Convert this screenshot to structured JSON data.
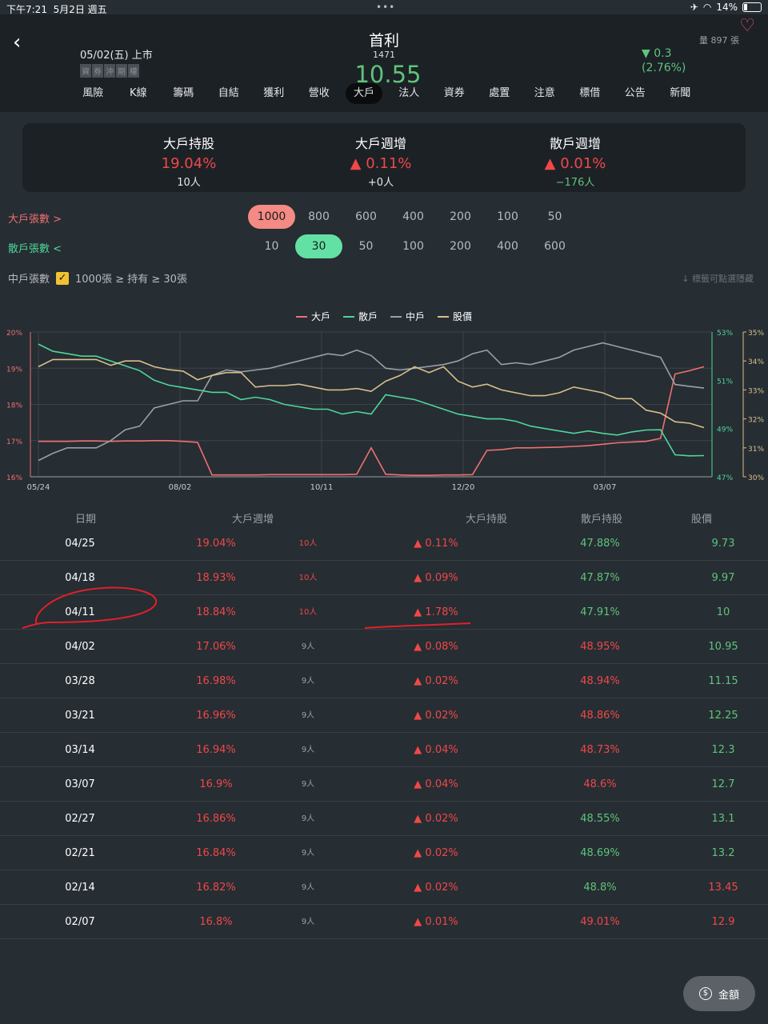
{
  "status": {
    "time": "下午7:21",
    "date": "5月2日 週五",
    "battery": "14%"
  },
  "header": {
    "name": "首利",
    "code": "1471",
    "price": "10.55",
    "listing": "05/02(五) 上市",
    "tags": [
      "資",
      "券",
      "沖",
      "期",
      "權"
    ],
    "volume": "量 897 張",
    "change": "▼ 0.3",
    "change_pct": "(2.76%)"
  },
  "nav": [
    "風險",
    "K線",
    "籌碼",
    "自結",
    "獲利",
    "營收",
    "大戶",
    "法人",
    "資券",
    "處置",
    "注意",
    "標借",
    "公告",
    "新聞"
  ],
  "nav_active": "大戶",
  "summary": [
    {
      "label": "大戶持股",
      "value": "19.04%",
      "sub": "10人"
    },
    {
      "label": "大戶週增",
      "value": "▲ 0.11%",
      "sub": "+0人"
    },
    {
      "label": "散戶週增",
      "value": "▲ 0.01%",
      "sub": "−176人"
    }
  ],
  "filters": {
    "big_label": "大戶張數  >",
    "big_options": [
      "1000",
      "800",
      "600",
      "400",
      "200",
      "100",
      "50"
    ],
    "big_selected": "1000",
    "retail_label": "散戶張數  <",
    "retail_options": [
      "10",
      "30",
      "50",
      "100",
      "200",
      "400",
      "600"
    ],
    "retail_selected": "30",
    "mid_label": "中戶張數",
    "mid_range": "1000張 ≥ 持有 ≥ 30張",
    "hint": "↓ 標籤可點選隱藏"
  },
  "chart_data": {
    "type": "line",
    "x_ticks": [
      "05/24",
      "08/02",
      "10/11",
      "12/20",
      "03/07"
    ],
    "y_left_ticks": [
      "20%",
      "19%",
      "18%",
      "17%",
      "16%"
    ],
    "y_left_range": [
      16,
      20
    ],
    "y_right1_ticks": [
      "53%",
      "51%",
      "49%",
      "47%"
    ],
    "y_right1_range": [
      47,
      53
    ],
    "y_right2_ticks": [
      "35%",
      "34%",
      "33%",
      "32%",
      "31%",
      "30%"
    ],
    "y_right2_range": [
      30,
      35
    ],
    "series": [
      {
        "name": "大戶",
        "color": "#f07070",
        "axis": "left",
        "values": [
          16.98,
          16.98,
          16.98,
          16.99,
          16.99,
          16.98,
          16.99,
          16.99,
          17.0,
          17.0,
          16.98,
          16.95,
          16.05,
          16.05,
          16.05,
          16.05,
          16.06,
          16.06,
          16.06,
          16.06,
          16.06,
          16.06,
          16.07,
          16.8,
          16.07,
          16.05,
          16.04,
          16.04,
          16.05,
          16.05,
          16.06,
          16.73,
          16.75,
          16.8,
          16.8,
          16.81,
          16.82,
          16.84,
          16.86,
          16.9,
          16.94,
          16.96,
          16.98,
          17.06,
          18.84,
          18.93,
          19.04
        ]
      },
      {
        "name": "散戶",
        "color": "#4fd69a",
        "axis": "right1",
        "values": [
          52.5,
          52.2,
          52.1,
          52.0,
          52.0,
          51.8,
          51.6,
          51.4,
          51.0,
          50.8,
          50.7,
          50.6,
          50.5,
          50.5,
          50.2,
          50.3,
          50.2,
          50.0,
          49.9,
          49.8,
          49.8,
          49.6,
          49.7,
          49.6,
          50.4,
          50.3,
          50.2,
          50.0,
          49.8,
          49.6,
          49.5,
          49.4,
          49.4,
          49.3,
          49.1,
          49.0,
          48.9,
          48.8,
          48.9,
          48.8,
          48.73,
          48.86,
          48.94,
          48.95,
          47.91,
          47.87,
          47.88
        ]
      },
      {
        "name": "中戶",
        "color": "#9aa0a6",
        "axis": "left",
        "values": [
          16.45,
          16.65,
          16.8,
          16.8,
          16.8,
          17.0,
          17.3,
          17.4,
          17.9,
          18.0,
          18.1,
          18.1,
          18.8,
          18.95,
          18.9,
          18.95,
          19.0,
          19.1,
          19.2,
          19.3,
          19.4,
          19.35,
          19.5,
          19.35,
          19.0,
          18.95,
          19.0,
          19.05,
          19.1,
          19.2,
          19.4,
          19.5,
          19.1,
          19.15,
          19.1,
          19.2,
          19.3,
          19.5,
          19.6,
          19.7,
          19.6,
          19.5,
          19.4,
          19.3,
          18.55,
          18.5,
          18.45
        ]
      },
      {
        "name": "股價",
        "color": "#d8c08a",
        "axis": "right2",
        "values": [
          33.8,
          34.05,
          34.05,
          34.05,
          34.05,
          33.85,
          34.0,
          34.0,
          33.8,
          33.7,
          33.65,
          33.35,
          33.5,
          33.6,
          33.6,
          33.1,
          33.15,
          33.15,
          33.2,
          33.1,
          33.0,
          33.0,
          33.05,
          32.95,
          33.3,
          33.5,
          33.8,
          33.6,
          33.8,
          33.3,
          33.1,
          33.2,
          33.0,
          32.9,
          32.8,
          32.8,
          32.9,
          33.1,
          33.0,
          32.9,
          32.7,
          32.7,
          32.3,
          32.2,
          31.9,
          31.85,
          31.7
        ]
      }
    ]
  },
  "table": {
    "headers": {
      "date": "日期",
      "big_weekly": "大戶週增",
      "big_hold": "大戶持股",
      "retail_hold": "散戶持股",
      "price": "股價"
    },
    "rows": [
      {
        "date": "04/25",
        "big": "19.04%",
        "ppl": "10人",
        "wk": "▲ 0.11%",
        "retail": "47.88%",
        "price": "9.73"
      },
      {
        "date": "04/18",
        "big": "18.93%",
        "ppl": "10人",
        "wk": "▲ 0.09%",
        "retail": "47.87%",
        "price": "9.97"
      },
      {
        "date": "04/11",
        "big": "18.84%",
        "ppl": "10人",
        "wk": "▲ 1.78%",
        "retail": "47.91%",
        "price": "10"
      },
      {
        "date": "04/02",
        "big": "17.06%",
        "ppl": "9人",
        "wk": "▲ 0.08%",
        "retail": "48.95%",
        "price": "10.95"
      },
      {
        "date": "03/28",
        "big": "16.98%",
        "ppl": "9人",
        "wk": "▲ 0.02%",
        "retail": "48.94%",
        "price": "11.15"
      },
      {
        "date": "03/21",
        "big": "16.96%",
        "ppl": "9人",
        "wk": "▲ 0.02%",
        "retail": "48.86%",
        "price": "12.25"
      },
      {
        "date": "03/14",
        "big": "16.94%",
        "ppl": "9人",
        "wk": "▲ 0.04%",
        "retail": "48.73%",
        "price": "12.3"
      },
      {
        "date": "03/07",
        "big": "16.9%",
        "ppl": "9人",
        "wk": "▲ 0.04%",
        "retail": "48.6%",
        "price": "12.7"
      },
      {
        "date": "02/27",
        "big": "16.86%",
        "ppl": "9人",
        "wk": "▲ 0.02%",
        "retail": "48.55%",
        "price": "13.1"
      },
      {
        "date": "02/21",
        "big": "16.84%",
        "ppl": "9人",
        "wk": "▲ 0.02%",
        "retail": "48.69%",
        "price": "13.2"
      },
      {
        "date": "02/14",
        "big": "16.82%",
        "ppl": "9人",
        "wk": "▲ 0.02%",
        "retail": "48.8%",
        "price": "13.45"
      },
      {
        "date": "02/07",
        "big": "16.8%",
        "ppl": "9人",
        "wk": "▲ 0.01%",
        "retail": "49.01%",
        "price": "12.9"
      }
    ]
  },
  "amount_button": "金額",
  "colors": {
    "red": "#f04848",
    "green": "#5fc47a",
    "bg": "#262d33"
  }
}
